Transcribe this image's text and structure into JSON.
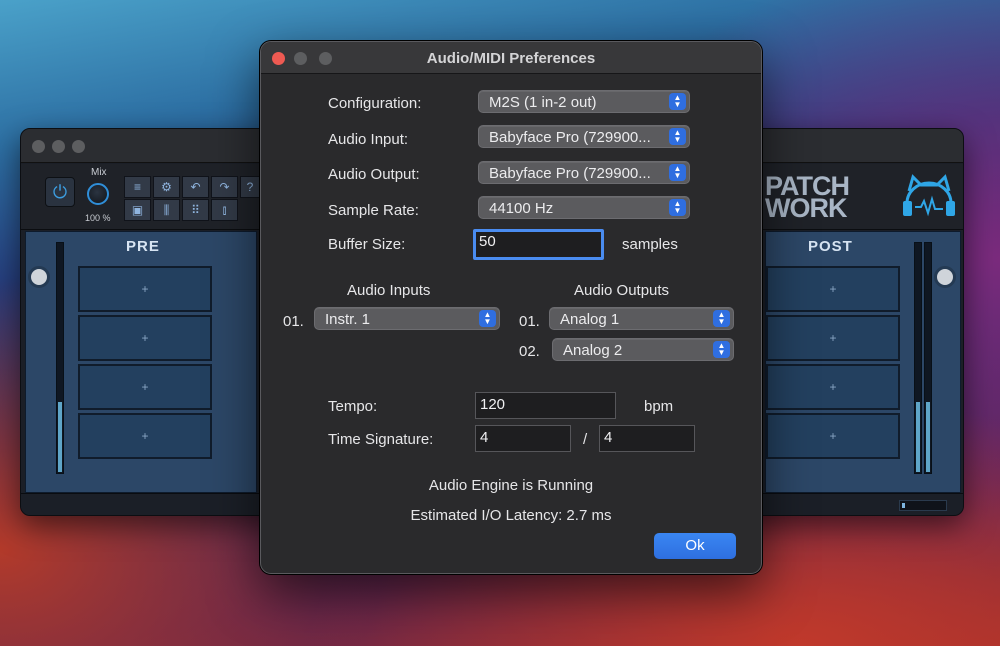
{
  "plugin": {
    "mix_label": "Mix",
    "mix_value": "100 %",
    "pre_label": "PRE",
    "post_label": "POST",
    "logo_line1": "PATCH",
    "logo_line2": "WORK",
    "slot_symbol": "+",
    "power_symbol": "⏻"
  },
  "dialog": {
    "title": "Audio/MIDI Preferences",
    "configuration": {
      "label": "Configuration:",
      "value": "M2S (1 in-2 out)"
    },
    "audio_input": {
      "label": "Audio Input:",
      "value": "Babyface Pro (729900..."
    },
    "audio_output": {
      "label": "Audio Output:",
      "value": "Babyface Pro (729900..."
    },
    "sample_rate": {
      "label": "Sample Rate:",
      "value": "44100 Hz"
    },
    "buffer_size": {
      "label": "Buffer Size:",
      "value": "50",
      "unit": "samples"
    },
    "inputs": {
      "header": "Audio Inputs",
      "items": [
        {
          "index": "01.",
          "value": "Instr. 1"
        }
      ]
    },
    "outputs": {
      "header": "Audio Outputs",
      "items": [
        {
          "index": "01.",
          "value": "Analog 1"
        },
        {
          "index": "02.",
          "value": "Analog 2"
        }
      ]
    },
    "tempo": {
      "label": "Tempo:",
      "value": "120",
      "unit": "bpm"
    },
    "time_signature": {
      "label": "Time Signature:",
      "numerator": "4",
      "separator": "/",
      "denominator": "4"
    },
    "status": "Audio Engine is Running",
    "latency": "Estimated I/O Latency: 2.7 ms",
    "ok_label": "Ok"
  },
  "colors": {
    "accent": "#2f6ee0",
    "close": "#ee5a52",
    "inactive_dot": "#5d5e60"
  }
}
